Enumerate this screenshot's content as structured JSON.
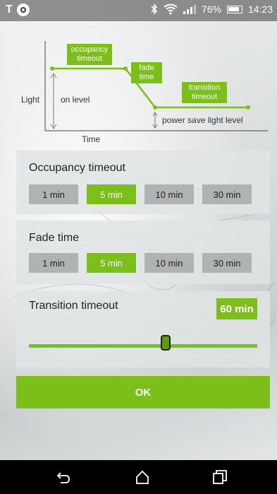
{
  "status_bar": {
    "app_icon_1": "T",
    "battery_percent": "76%",
    "time": "14:23",
    "icons": [
      "bluetooth-icon",
      "wifi-icon",
      "signal-icon",
      "battery-icon"
    ]
  },
  "diagram": {
    "y_axis_label": "Light",
    "x_axis_label": "Time",
    "on_level_label": "on level",
    "occupancy_label": "occupancy\ntimeout",
    "fade_label": "fade\ntime",
    "transition_label": "transition\ntimeout",
    "power_save_label": "power save light level"
  },
  "occupancy": {
    "title": "Occupancy timeout",
    "options": [
      "1 min",
      "5 min",
      "10 min",
      "30 min"
    ],
    "selected": "5 min"
  },
  "fade": {
    "title": "Fade time",
    "options": [
      "1 min",
      "5 min",
      "10 min",
      "30 min"
    ],
    "selected": "5 min"
  },
  "transition": {
    "title": "Transition timeout",
    "value": "60 min",
    "slider_fraction": 0.6
  },
  "actions": {
    "ok_label": "OK"
  },
  "colors": {
    "accent": "#7cbf1a",
    "inactive_button": "#b0b3b4"
  },
  "nav_bar": {
    "icons": [
      "back-icon",
      "home-icon",
      "recents-icon"
    ]
  }
}
